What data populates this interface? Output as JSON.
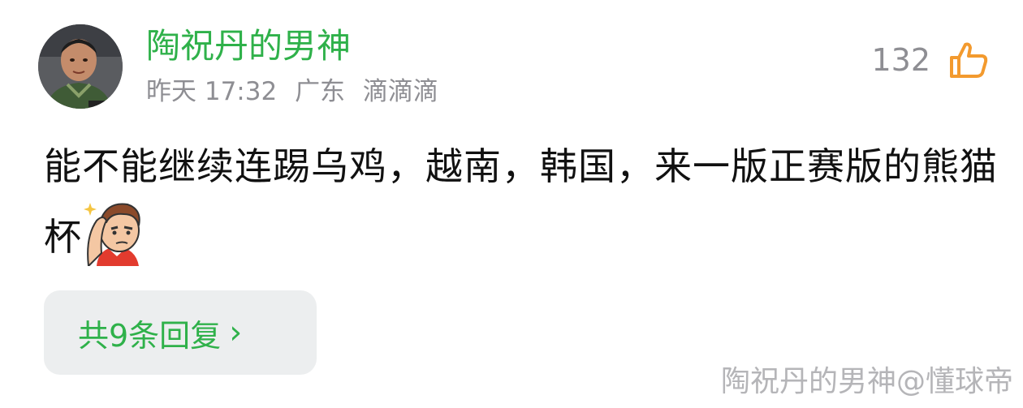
{
  "comment": {
    "user": {
      "name": "陶祝丹的男神",
      "avatar_icon": "user-avatar-photo"
    },
    "meta": {
      "time": "昨天 17:32",
      "location": "广东",
      "device": "滴滴滴"
    },
    "likes": {
      "count": "132",
      "icon": "thumbs-up-icon"
    },
    "text": "能不能继续连踢乌鸡，越南，韩国，来一版正赛版的熊猫杯",
    "emoji": "thinking-face-emoji",
    "replies": {
      "label": "共9条回复",
      "chevron": "›"
    }
  },
  "watermark": "陶祝丹的男神@懂球帝",
  "colors": {
    "accent_green": "#2fb14a",
    "meta_gray": "#8e8e93",
    "like_orange": "#f39a2e",
    "reply_bg": "#eceeef"
  }
}
